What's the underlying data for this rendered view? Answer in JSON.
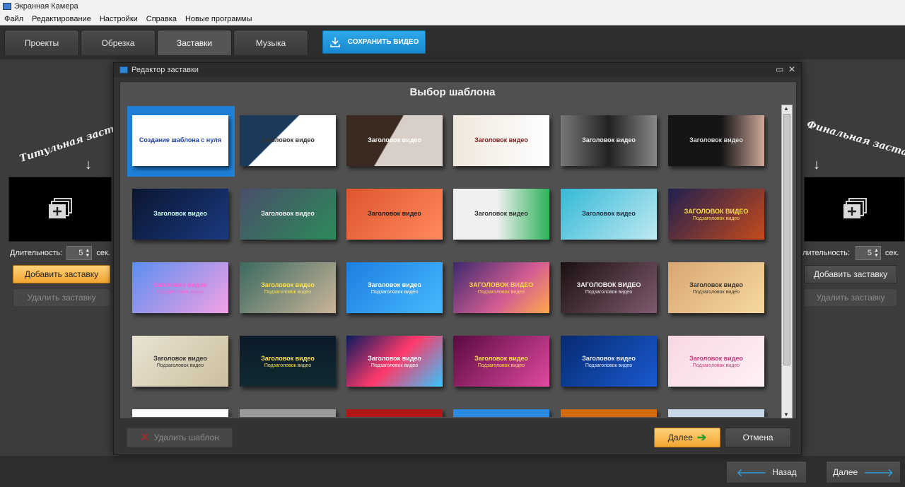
{
  "window": {
    "title": "Экранная Камера"
  },
  "menu": [
    "Файл",
    "Редактирование",
    "Настройки",
    "Справка",
    "Новые программы"
  ],
  "tabs": [
    "Проекты",
    "Обрезка",
    "Заставки",
    "Музыка"
  ],
  "active_tab": "Заставки",
  "save_button": "СОХРАНИТЬ ВИДЕО",
  "left": {
    "label": "Титульная заставка",
    "duration_label": "Длительность:",
    "duration_value": "5",
    "unit": "сек.",
    "add_button": "Добавить заставку",
    "delete_button": "Удалить заставку"
  },
  "right": {
    "label": "Финальная заставка",
    "duration_label": "лительность:",
    "duration_value": "5",
    "unit": "сек.",
    "add_button": "Добавить заставку",
    "delete_button": "Удалить заставку"
  },
  "dialog": {
    "title": "Редактор заставки",
    "heading": "Выбор шаблона",
    "delete_template": "Удалить шаблон",
    "next": "Далее",
    "cancel": "Отмена"
  },
  "templates": [
    {
      "t1": "Создание шаблона с нуля",
      "t2": ""
    },
    {
      "t1": "Заголовок видео",
      "t2": ""
    },
    {
      "t1": "Заголовок видео",
      "t2": ""
    },
    {
      "t1": "Заголовок видео",
      "t2": ""
    },
    {
      "t1": "Заголовок видео",
      "t2": ""
    },
    {
      "t1": "Заголовок видео",
      "t2": ""
    },
    {
      "t1": "Заголовок видео",
      "t2": ""
    },
    {
      "t1": "Заголовок видео",
      "t2": ""
    },
    {
      "t1": "Заголовок видео",
      "t2": ""
    },
    {
      "t1": "Заголовок видео",
      "t2": ""
    },
    {
      "t1": "Заголовок видео",
      "t2": ""
    },
    {
      "t1": "ЗАГОЛОВОК ВИДЕО",
      "t2": "Подзаголовок видео"
    },
    {
      "t1": "Заголовок видео",
      "t2": "Подзаголовок видео"
    },
    {
      "t1": "Заголовок видео",
      "t2": "Подзаголовок видео"
    },
    {
      "t1": "Заголовок видео",
      "t2": "Подзаголовок видео"
    },
    {
      "t1": "ЗАГОЛОВОК ВИДЕО",
      "t2": "Подзаголовок видео"
    },
    {
      "t1": "ЗАГОЛОВОК ВИДЕО",
      "t2": "Подзаголовок видео"
    },
    {
      "t1": "Заголовок видео",
      "t2": "Подзаголовок видео"
    },
    {
      "t1": "Заголовок видео",
      "t2": "Подзаголовок видео"
    },
    {
      "t1": "Заголовок видео",
      "t2": "Подзаголовок видео"
    },
    {
      "t1": "Заголовок видео",
      "t2": "Подзаголовок видео"
    },
    {
      "t1": "Заголовок видео",
      "t2": "Подзаголовок видео"
    },
    {
      "t1": "Заголовок видео",
      "t2": "Подзаголовок видео"
    },
    {
      "t1": "Заголовок видео",
      "t2": "Подзаголовок видео"
    }
  ],
  "nav": {
    "back": "Назад",
    "next": "Далее"
  }
}
